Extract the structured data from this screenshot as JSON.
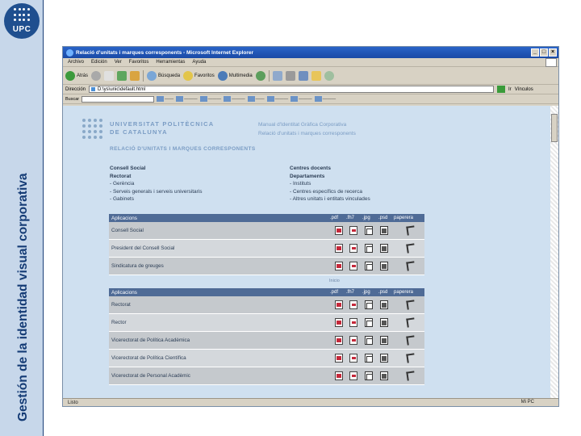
{
  "slide": {
    "side_title": "Gestión de la identidad visual corporativa",
    "logo_text": "UPC"
  },
  "browser": {
    "title": "Relació d'unitats i marques corresponents - Microsoft Internet Explorer",
    "menus": [
      "Archivo",
      "Edición",
      "Ver",
      "Favoritos",
      "Herramientas",
      "Ayuda"
    ],
    "toolbar": {
      "back": "Atrás",
      "search": "Búsqueda",
      "favorites": "Favoritos",
      "multimedia": "Multimedia"
    },
    "address": {
      "label": "Dirección",
      "value": "D:\\ys\\unic\\default.html"
    },
    "go_label": "Ir",
    "vinculos_label": "Vínculos",
    "search_label": "Buscar",
    "status_left": "Listo",
    "status_zone": "Mi PC",
    "colors": {
      "header_bg": "#4f6b96",
      "viewport_bg": "#cfe0f0",
      "titlebar": "#2a64c8"
    }
  },
  "page": {
    "univ_line1": "UNIVERSITAT POLITÈCNICA",
    "univ_line2": "DE CATALUNYA",
    "manual_line1": "Manual d'Identitat Gràfica Corporativa",
    "manual_line2": "Relació d'unitats i marques corresponents",
    "heading": "RELACIÓ D'UNITATS I MARQUES CORRESPONENTS",
    "col1": {
      "h1": "Consell Social",
      "h2": "Rectorat",
      "items": [
        "- Gerència",
        "- Serveis generals i serveis universitaris",
        "- Gabinets"
      ]
    },
    "col2": {
      "h1": "Centres docents",
      "h2": "Departaments",
      "items": [
        "- Instituts",
        "- Centres específics de recerca",
        "- Altres unitats i entitats vinculades"
      ]
    },
    "table_cols": [
      ".pdf",
      ".fh7",
      ".jpg",
      ".psd",
      "paperera"
    ],
    "table1": {
      "header": "Aplicacions",
      "rows": [
        "Consell Social",
        "President del Consell Social",
        "Sindicatura de greuges"
      ]
    },
    "note": "Inicio",
    "table2": {
      "header": "Aplicacions",
      "rows": [
        "Rectorat",
        "Rector",
        "Vicerectorat de Política Acadèmica",
        "Vicerectorat de Política Científica",
        "Vicerectorat de Personal Acadèmic"
      ]
    }
  }
}
